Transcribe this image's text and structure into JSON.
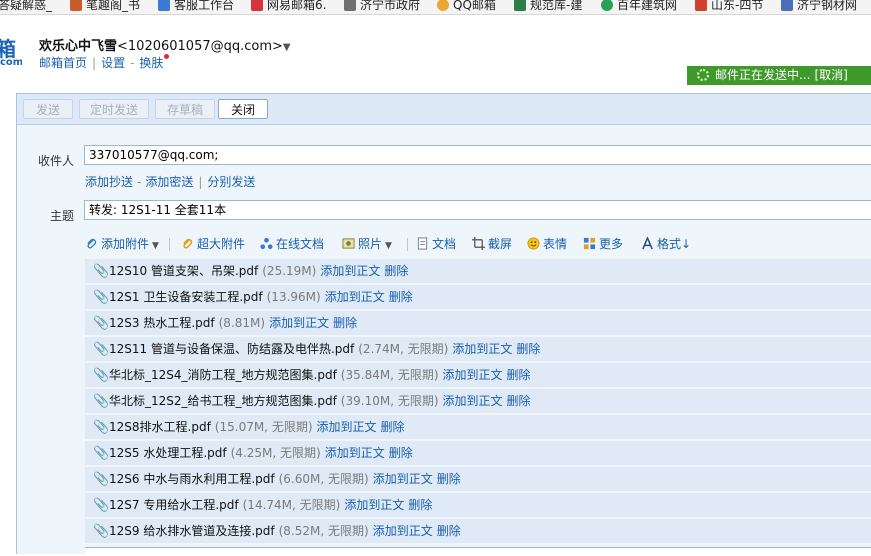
{
  "bookmarks": [
    {
      "label": "答疑解惑_",
      "color": "#4a8fd8"
    },
    {
      "label": "笔趣阁_书",
      "color": "#c75b2a"
    },
    {
      "label": "客服工作台",
      "color": "#3a7bd5"
    },
    {
      "label": "网易邮箱6.",
      "color": "#d6333a"
    },
    {
      "label": "济宁市政府",
      "color": "#6f6f6f"
    },
    {
      "label": "QQ邮箱",
      "color": "#e8a92e"
    },
    {
      "label": "规范库-建",
      "color": "#2d7d46"
    },
    {
      "label": "百年建筑网",
      "color": "#2aa05a"
    },
    {
      "label": "山东-四节",
      "color": "#d2402e"
    },
    {
      "label": "济宁钢材网",
      "color": "#4a6fb5"
    }
  ],
  "header": {
    "logo_char": "箱",
    "logo_suffix": "com",
    "account_name": "欢乐心中飞雪",
    "account_email": "<1020601057@qq.com>",
    "account_caret": "▼",
    "links": {
      "home": "邮箱首页",
      "sep": "|",
      "settings": "设置",
      "dash": "-",
      "skin": "换肤"
    }
  },
  "status": {
    "sending_text": "邮件正在发送中...",
    "cancel_label": "[取消]",
    "accent": "#3f9a2b"
  },
  "actions": {
    "send": "发送",
    "scheduled": "定时发送",
    "save_draft": "存草稿",
    "close": "关闭"
  },
  "form": {
    "to_label": "收件人",
    "to_value": "337010577@qq.com;",
    "cc_links": {
      "add_cc": "添加抄送",
      "dash": "-",
      "add_bcc": "添加密送",
      "bar": "|",
      "separate": "分别发送"
    },
    "subject_label": "主题",
    "subject_value": "转发: 12S1-11 全套11本"
  },
  "toolbar": [
    {
      "label": "添加附件",
      "icon": "paperclip-icon",
      "dropdown": "▼"
    },
    {
      "label": "超大附件",
      "icon": "large-attachment-icon"
    },
    {
      "label": "在线文档",
      "icon": "online-doc-icon"
    },
    {
      "label": "照片",
      "icon": "photo-icon",
      "dropdown": "▼"
    },
    {
      "label": "文档",
      "icon": "document-icon"
    },
    {
      "label": "截屏",
      "icon": "screenshot-icon"
    },
    {
      "label": "表情",
      "icon": "emoji-icon"
    },
    {
      "label": "更多",
      "icon": "more-icon"
    },
    {
      "label": "格式↓",
      "icon": "format-icon"
    }
  ],
  "attachments": [
    {
      "name": "12S10 管道支架、吊架.pdf",
      "meta": "(25.19M)",
      "add": "添加到正文",
      "del": "删除",
      "clip_color": "#3a78c9"
    },
    {
      "name": "12S1 卫生设备安装工程.pdf",
      "meta": "(13.96M)",
      "add": "添加到正文",
      "del": "删除",
      "clip_color": "#3a78c9"
    },
    {
      "name": "12S3 热水工程.pdf",
      "meta": "(8.81M)",
      "add": "添加到正文",
      "del": "删除",
      "clip_color": "#3a78c9"
    },
    {
      "name": "12S11 管道与设备保温、防结露及电伴热.pdf",
      "meta": "(2.74M, 无限期)",
      "add": "添加到正文",
      "del": "删除",
      "clip_color": "#e0a020"
    },
    {
      "name": "华北标_12S4_消防工程_地方规范图集.pdf",
      "meta": "(35.84M, 无限期)",
      "add": "添加到正文",
      "del": "删除",
      "clip_color": "#e0a020"
    },
    {
      "name": "华北标_12S2_给书工程_地方规范图集.pdf",
      "meta": "(39.10M, 无限期)",
      "add": "添加到正文",
      "del": "删除",
      "clip_color": "#e0a020"
    },
    {
      "name": "12S8排水工程.pdf",
      "meta": "(15.07M, 无限期)",
      "add": "添加到正文",
      "del": "删除",
      "clip_color": "#e0a020"
    },
    {
      "name": "12S5 水处理工程.pdf",
      "meta": "(4.25M, 无限期)",
      "add": "添加到正文",
      "del": "删除",
      "clip_color": "#e0a020"
    },
    {
      "name": "12S6 中水与雨水利用工程.pdf",
      "meta": "(6.60M, 无限期)",
      "add": "添加到正文",
      "del": "删除",
      "clip_color": "#e0a020"
    },
    {
      "name": "12S7 专用给水工程.pdf",
      "meta": "(14.74M, 无限期)",
      "add": "添加到正文",
      "del": "删除",
      "clip_color": "#e0a020"
    },
    {
      "name": "12S9 给水排水管道及连接.pdf",
      "meta": "(8.52M, 无限期)",
      "add": "添加到正文",
      "del": "删除",
      "clip_color": "#e0a020"
    }
  ]
}
